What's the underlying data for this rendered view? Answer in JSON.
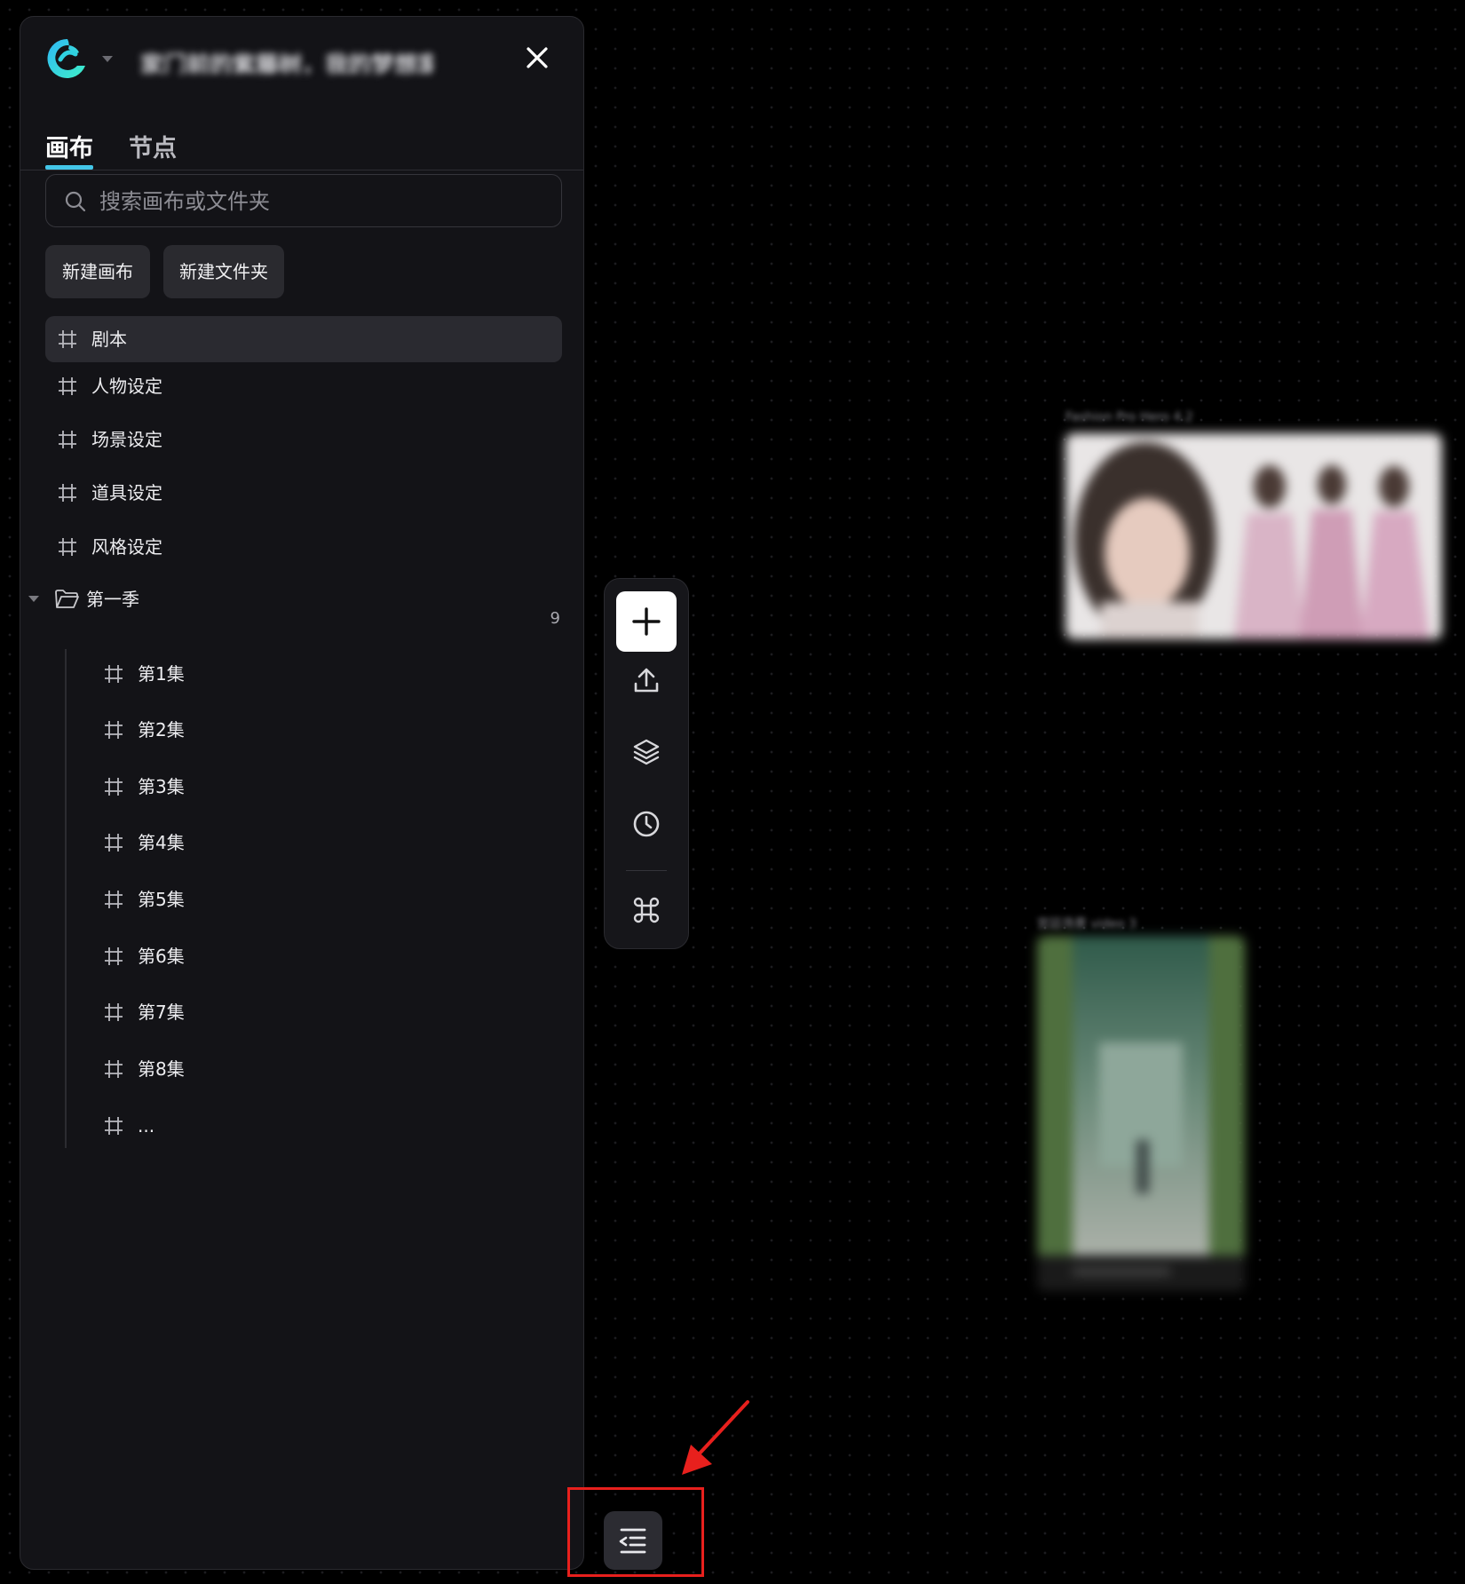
{
  "header": {
    "project_title": "家门前的紫藤树，我的梦想家门",
    "close_label": "×"
  },
  "tabs": [
    {
      "label": "画布",
      "active": true
    },
    {
      "label": "节点",
      "active": false
    }
  ],
  "search": {
    "placeholder": "搜索画布或文件夹",
    "value": ""
  },
  "actions": {
    "new_canvas": "新建画布",
    "new_folder": "新建文件夹"
  },
  "canvases": [
    {
      "label": "剧本",
      "selected": true
    },
    {
      "label": "人物设定"
    },
    {
      "label": "场景设定"
    },
    {
      "label": "道具设定"
    },
    {
      "label": "风格设定"
    }
  ],
  "folder": {
    "label": "第一季",
    "count": "9",
    "children": [
      {
        "label": "第1集"
      },
      {
        "label": "第2集"
      },
      {
        "label": "第3集"
      },
      {
        "label": "第4集"
      },
      {
        "label": "第5集"
      },
      {
        "label": "第6集"
      },
      {
        "label": "第7集"
      },
      {
        "label": "第8集"
      },
      {
        "label": "..."
      }
    ]
  },
  "toolbar": {
    "icons": [
      "plus-icon",
      "upload-icon",
      "layers-icon",
      "history-icon",
      "command-icon"
    ]
  },
  "canvas_cards": [
    {
      "label": "Fashion Pro Hero 4.2"
    },
    {
      "label": "宫廷场景 video 3"
    }
  ],
  "colors": {
    "accent": "#43c6e8",
    "panel_bg": "#131317",
    "button_bg": "#2a2a2f",
    "highlight": "#e8201d"
  }
}
